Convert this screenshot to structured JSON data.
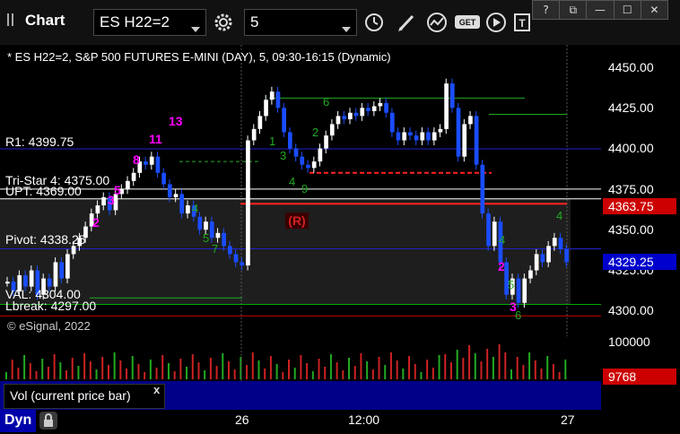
{
  "toolbar": {
    "app_title": "Chart",
    "symbol": "ES H22=2",
    "interval": "5"
  },
  "window_controls": [
    "?",
    "⧉",
    "—",
    "☐",
    "✕"
  ],
  "chart_header": "* ES H22=2, S&P 500 FUTURES E-MINI (DAY), 5, 09:30-16:15 (Dynamic)",
  "watermark": "© eSignal, 2022",
  "levels": [
    {
      "label": "R1: 4399.75",
      "value": 4399.75,
      "color": "#2222cc"
    },
    {
      "label": "Tri-Star 4: 4375.00",
      "value": 4375.0,
      "color": "#ffffff"
    },
    {
      "label": "UPT: 4369.00",
      "value": 4369.0,
      "color": "#ffffff"
    },
    {
      "label": "Pivot: 4338.25",
      "value": 4338.25,
      "color": "#2222cc"
    },
    {
      "label": "VAL: 4304.00",
      "value": 4304.0,
      "color": "#00aa00"
    },
    {
      "label": "Lbreak: 4297.00",
      "value": 4297.0,
      "color": "#cc0000"
    }
  ],
  "reversal_marker": "(R)",
  "price_axis": {
    "ticks": [
      "4450.00",
      "4425.00",
      "4400.00",
      "4375.00",
      "4350.00",
      "4325.00",
      "4300.00"
    ],
    "red_box": "4363.75",
    "blue_box": "4329.25"
  },
  "volume": {
    "axis_tick": "100000",
    "current_box": "9768",
    "tab_label": "Vol (current price bar)",
    "tab_close": "x"
  },
  "x_axis": {
    "ticks": [
      "26",
      "12:00",
      "27"
    ]
  },
  "status": {
    "label": "Dyn"
  },
  "colors": {
    "up_bar": "#ffffff",
    "down_bar": "#1a4dff",
    "seq_magenta": "#ff00ff",
    "seq_green": "#22aa22",
    "volume_bar": "#cc2222",
    "volume_up": "#22aa22"
  },
  "chart_data": {
    "type": "candlestick",
    "title": "* ES H22=2, S&P 500 FUTURES E-MINI (DAY), 5, 09:30-16:15 (Dynamic)",
    "ylim": [
      4290,
      4455
    ],
    "yticks": [
      4450,
      4425,
      4400,
      4375,
      4350,
      4325,
      4300
    ],
    "xticks": [
      "26",
      "12:00",
      "27"
    ],
    "closes": [
      4318,
      4312,
      4322,
      4315,
      4325,
      4310,
      4320,
      4315,
      4330,
      4320,
      4335,
      4340,
      4345,
      4352,
      4360,
      4365,
      4370,
      4362,
      4372,
      4375,
      4380,
      4385,
      4392,
      4390,
      4395,
      4385,
      4378,
      4370,
      4372,
      4360,
      4365,
      4358,
      4350,
      4355,
      4345,
      4348,
      4340,
      4335,
      4330,
      4328,
      4405,
      4412,
      4420,
      4430,
      4435,
      4425,
      4410,
      4400,
      4395,
      4390,
      4388,
      4392,
      4400,
      4408,
      4415,
      4420,
      4418,
      4422,
      4420,
      4425,
      4423,
      4426,
      4428,
      4422,
      4410,
      4405,
      4410,
      4408,
      4405,
      4410,
      4405,
      4410,
      4412,
      4440,
      4425,
      4395,
      4415,
      4420,
      4390,
      4360,
      4340,
      4355,
      4330,
      4310,
      4320,
      4305,
      4320,
      4325,
      4335,
      4330,
      4340,
      4345,
      4338,
      4330
    ]
  }
}
